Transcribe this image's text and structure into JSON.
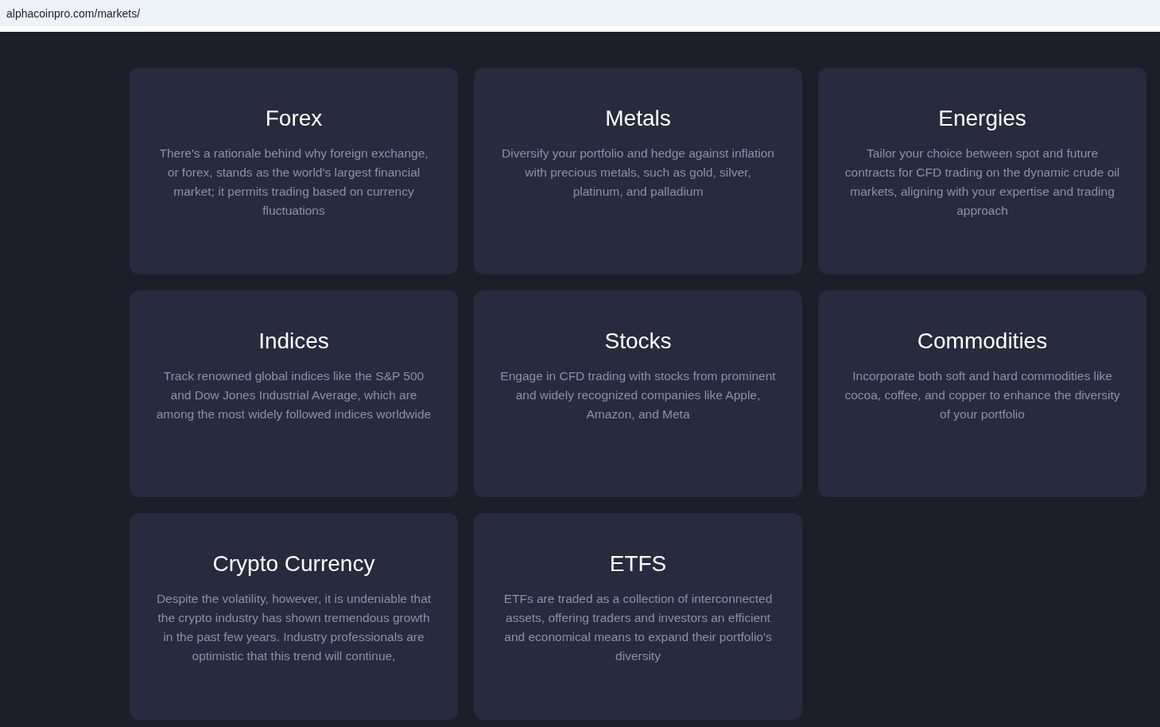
{
  "address_bar": {
    "url": "alphacoinpro.com/markets/"
  },
  "markets": [
    {
      "title": "Forex",
      "description": "There's a rationale behind why foreign exchange, or forex, stands as the world's largest financial market; it permits trading based on currency fluctuations"
    },
    {
      "title": "Metals",
      "description": "Diversify your portfolio and hedge against inflation with precious metals, such as gold, silver, platinum, and palladium"
    },
    {
      "title": "Energies",
      "description": "Tailor your choice between spot and future contracts for CFD trading on the dynamic crude oil markets, aligning with your expertise and trading approach"
    },
    {
      "title": "Indices",
      "description": "Track renowned global indices like the S&P 500 and Dow Jones Industrial Average, which are among the most widely followed indices worldwide"
    },
    {
      "title": "Stocks",
      "description": "Engage in CFD trading with stocks from prominent and widely recognized companies like Apple, Amazon, and Meta"
    },
    {
      "title": "Commodities",
      "description": "Incorporate both soft and hard commodities like cocoa, coffee, and copper to enhance the diversity of your portfolio"
    },
    {
      "title": "Crypto Currency",
      "description": "Despite the volatility, however, it is undeniable that the crypto industry has shown tremendous growth in the past few years. Industry professionals are optimistic that this trend will continue,"
    },
    {
      "title": "ETFS",
      "description": "ETFs are traded as a collection of interconnected assets, offering traders and investors an efficient and economical means to expand their portfolio's diversity"
    }
  ]
}
